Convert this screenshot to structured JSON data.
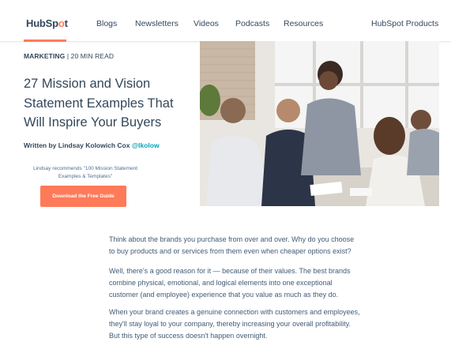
{
  "brand": {
    "logo_main": "HubSp",
    "logo_o": "o",
    "logo_end": "t"
  },
  "nav": {
    "blogs": "Blogs",
    "newsletters": "Newsletters",
    "videos": "Videos",
    "podcasts": "Podcasts",
    "resources": "Resources",
    "products": "HubSpot Products"
  },
  "article": {
    "category": "MARKETING",
    "read_time": "| 20 MIN READ",
    "title": "27 Mission and Vision Statement Examples That Will Inspire Your Buyers",
    "author_prefix": "Written by Lindsay Kolowich Cox",
    "author_handle": "@lkolow",
    "recommendation": "Lindsay recommends \"100 Mission Statement Examples & Templates\"",
    "cta_label": "Download the Free Guide",
    "paragraphs": [
      "Think about the brands you purchase from over and over. Why do you choose to buy products and or services from them even when cheaper options exist?",
      "Well, there's a good reason for it — because of their values. The best brands combine physical, emotional, and logical elements into one exceptional customer (and employee) experience that you value as much as they do.",
      "When your brand creates a genuine connection with customers and employees, they'll stay loyal to your company, thereby increasing your overall profitability. But this type of success doesn't happen overnight."
    ]
  },
  "colors": {
    "accent": "#ff7a59",
    "text": "#33475b",
    "link": "#00a4bd"
  }
}
